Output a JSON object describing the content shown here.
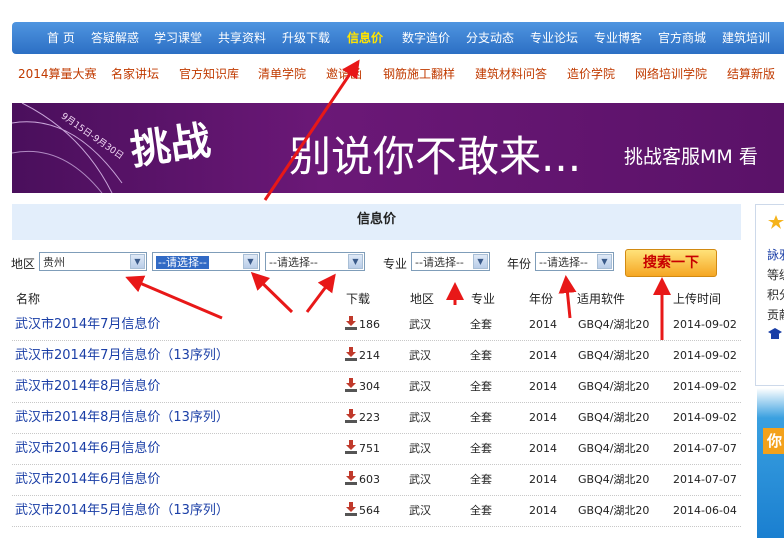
{
  "top_nav": [
    {
      "label": "首 页"
    },
    {
      "label": "答疑解惑"
    },
    {
      "label": "学习课堂"
    },
    {
      "label": "共享资料"
    },
    {
      "label": "升级下载"
    },
    {
      "label": "信息价",
      "active": true
    },
    {
      "label": "数字造价"
    },
    {
      "label": "分支动态"
    },
    {
      "label": "专业论坛"
    },
    {
      "label": "专业博客"
    },
    {
      "label": "官方商城"
    },
    {
      "label": "建筑培训"
    }
  ],
  "sub_nav": [
    {
      "label": "2014算量大赛"
    },
    {
      "label": "名家讲坛"
    },
    {
      "label": "官方知识库"
    },
    {
      "label": "清单学院"
    },
    {
      "label": "邀请函"
    },
    {
      "label": "钢筋施工翻样"
    },
    {
      "label": "建筑材料问答"
    },
    {
      "label": "造价学院"
    },
    {
      "label": "网络培训学院"
    },
    {
      "label": "结算新版"
    }
  ],
  "banner": {
    "date": "9月15日-9月30日",
    "challenge": "挑战",
    "slogan": "别说你不敢来...",
    "service": "挑战客服MM 看"
  },
  "info_header": "信息价",
  "filters": {
    "region_label": "地区",
    "region_value": "贵州",
    "city_value": "--请选择--",
    "district_value": "--请选择--",
    "major_label": "专业",
    "major_value": "--请选择--",
    "year_label": "年份",
    "year_value": "--请选择--",
    "search_button": "搜索一下"
  },
  "table": {
    "headers": {
      "name": "名称",
      "downloads": "下载",
      "region": "地区",
      "major": "专业",
      "year": "年份",
      "software": "适用软件",
      "upload_time": "上传时间"
    },
    "rows": [
      {
        "name": "武汉市2014年7月信息价",
        "downloads": "186",
        "region": "武汉",
        "major": "全套",
        "year": "2014",
        "software": "GBQ4/湖北20",
        "date": "2014-09-02"
      },
      {
        "name": "武汉市2014年7月信息价（13序列）",
        "downloads": "214",
        "region": "武汉",
        "major": "全套",
        "year": "2014",
        "software": "GBQ4/湖北20",
        "date": "2014-09-02"
      },
      {
        "name": "武汉市2014年8月信息价",
        "downloads": "304",
        "region": "武汉",
        "major": "全套",
        "year": "2014",
        "software": "GBQ4/湖北20",
        "date": "2014-09-02"
      },
      {
        "name": "武汉市2014年8月信息价（13序列）",
        "downloads": "223",
        "region": "武汉",
        "major": "全套",
        "year": "2014",
        "software": "GBQ4/湖北20",
        "date": "2014-09-02"
      },
      {
        "name": "武汉市2014年6月信息价",
        "downloads": "751",
        "region": "武汉",
        "major": "全套",
        "year": "2014",
        "software": "GBQ4/湖北20",
        "date": "2014-07-07"
      },
      {
        "name": "武汉市2014年6月信息价",
        "downloads": "603",
        "region": "武汉",
        "major": "全套",
        "year": "2014",
        "software": "GBQ4/湖北20",
        "date": "2014-07-07"
      },
      {
        "name": "武汉市2014年5月信息价（13序列）",
        "downloads": "564",
        "region": "武汉",
        "major": "全套",
        "year": "2014",
        "software": "GBQ4/湖北20",
        "date": "2014-06-04"
      }
    ]
  },
  "sidebar": {
    "line1": "詠邪",
    "line2": "等级",
    "line3": "积分",
    "line4": "贡献",
    "promo": "你"
  },
  "colors": {
    "nav_bg": "#3b82d6",
    "active": "#ffe400",
    "sub_nav_text": "#c03a00",
    "link": "#1a3ea6",
    "annotation": "#e81818",
    "button": "#f5a623"
  }
}
